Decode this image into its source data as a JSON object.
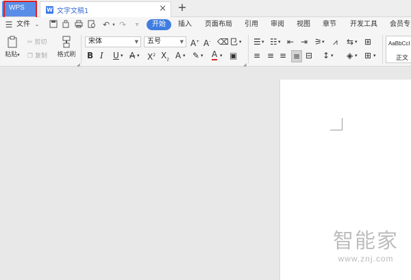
{
  "tabbar": {
    "wps_label": "WPS",
    "doc_icon": "W",
    "doc_title": "文字文稿1",
    "close_glyph": "×",
    "new_tab_glyph": "+"
  },
  "menubar": {
    "file_label": "文件",
    "tabs": [
      "开始",
      "插入",
      "页面布局",
      "引用",
      "审阅",
      "视图",
      "章节",
      "开发工具",
      "会员专"
    ],
    "active_tab": "开始",
    "icons": [
      "save-icon",
      "clipboard-icon",
      "print-icon",
      "print-preview-icon",
      "undo-icon",
      "redo-icon",
      "more-icon"
    ]
  },
  "ribbon": {
    "paste_label": "粘贴",
    "cut_label": "剪切",
    "copy_label": "复制",
    "format_painter_label": "格式刷",
    "font_name": "宋体",
    "font_size": "五号",
    "style_sample": "AaBbCcI",
    "style_name": "正文"
  },
  "watermark": {
    "title": "智能家",
    "url": "www.znj.com"
  },
  "colors": {
    "wps_tab": "#5a8de8",
    "active_pill": "#3f7de0",
    "highlight_box": "#e21d1d"
  }
}
